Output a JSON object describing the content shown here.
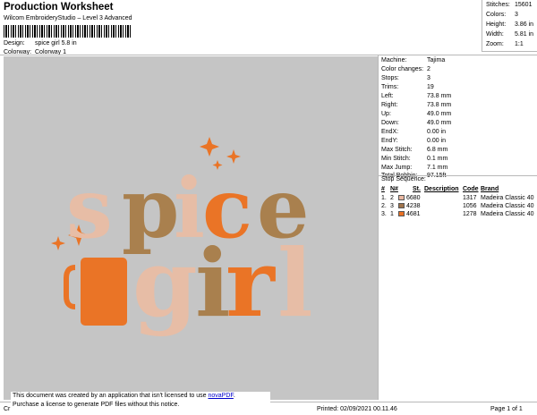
{
  "header": {
    "title": "Production Worksheet",
    "software": "Wilcom EmbroideryStudio – Level 3 Advanced",
    "design_label": "Design:",
    "design_value": "spice girl 5.8 in",
    "colorway_label": "Colorway:",
    "colorway_value": "Colorway 1"
  },
  "stats": [
    {
      "label": "Stitches:",
      "value": "15601"
    },
    {
      "label": "Colors:",
      "value": "3"
    },
    {
      "label": "Height:",
      "value": "3.86 in"
    },
    {
      "label": "Width:",
      "value": "5.81 in"
    },
    {
      "label": "Zoom:",
      "value": "1:1"
    }
  ],
  "machine": [
    {
      "label": "Machine:",
      "value": "Tajima"
    },
    {
      "label": "Color changes:",
      "value": "2"
    },
    {
      "label": "Stops:",
      "value": "3"
    },
    {
      "label": "Trims:",
      "value": "19"
    },
    {
      "label": "Left:",
      "value": "73.8 mm"
    },
    {
      "label": "Right:",
      "value": "73.8 mm"
    },
    {
      "label": "Up:",
      "value": "49.0 mm"
    },
    {
      "label": "Down:",
      "value": "49.0 mm"
    },
    {
      "label": "EndX:",
      "value": "0.00 in"
    },
    {
      "label": "EndY:",
      "value": "0.00 in"
    },
    {
      "label": "Max Stitch:",
      "value": "6.8 mm"
    },
    {
      "label": "Min Stitch:",
      "value": "0.1 mm"
    },
    {
      "label": "Max Jump:",
      "value": "7.1 mm"
    },
    {
      "label": "Total Bobbin:",
      "value": "97.15ft"
    }
  ],
  "stop_sequence": {
    "title": "Stop Sequence:",
    "headers": {
      "num": "#",
      "n": "N#",
      "st": "St.",
      "desc": "Description",
      "code": "Code",
      "brand": "Brand"
    },
    "rows": [
      {
        "num": "1.",
        "n": "2",
        "color": "#e9b7a1",
        "code": "6680",
        "st": "1317",
        "brand": "Madeira Classic 40"
      },
      {
        "num": "2.",
        "n": "3",
        "color": "#a0744c",
        "code": "4238",
        "st": "1056",
        "brand": "Madeira Classic 40"
      },
      {
        "num": "3.",
        "n": "1",
        "color": "#ea7124",
        "code": "4681",
        "st": "1278",
        "brand": "Madeira Classic 40"
      }
    ]
  },
  "design_text": {
    "line1": "spice",
    "line2": "girl",
    "colors": {
      "peach": "#e7bda6",
      "brown": "#a9804e",
      "orange": "#ea7426",
      "background": "#c5c5c5"
    }
  },
  "notice": {
    "line1_prefix": "This document was created by an application that isn't licensed to use ",
    "link": "novaPDF",
    "line1_suffix": ".",
    "line2": "Purchase a license to generate PDF files without this notice."
  },
  "footer": {
    "left": "Cr",
    "printed": "Printed: 02/09/2021 00.11.46",
    "page": "Page 1 of 1"
  }
}
